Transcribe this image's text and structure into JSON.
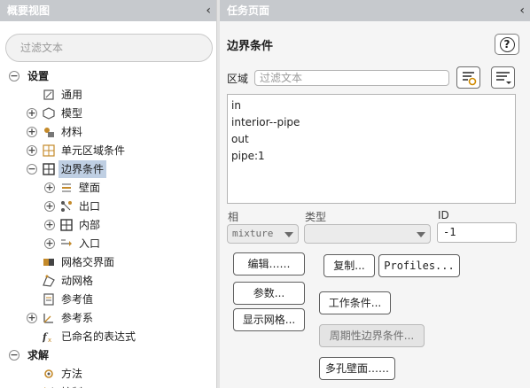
{
  "left_panel": {
    "title": "概要视图",
    "collapse_glyph": "‹",
    "filter_placeholder": "过滤文本",
    "tree": [
      {
        "label": "设置",
        "level": 0,
        "toggle": "−",
        "bold": true,
        "icon": ""
      },
      {
        "label": "通用",
        "level": 1,
        "toggle": "",
        "icon": "general-icon"
      },
      {
        "label": "模型",
        "level": 1,
        "toggle": "+",
        "icon": "models-icon"
      },
      {
        "label": "材料",
        "level": 1,
        "toggle": "+",
        "icon": "materials-icon"
      },
      {
        "label": "单元区域条件",
        "level": 1,
        "toggle": "+",
        "icon": "cell-zone-icon"
      },
      {
        "label": "边界条件",
        "level": 1,
        "toggle": "−",
        "icon": "boundary-conditions-icon",
        "selected": true
      },
      {
        "label": "壁面",
        "level": 2,
        "toggle": "+",
        "icon": "wall-icon"
      },
      {
        "label": "出口",
        "level": 2,
        "toggle": "+",
        "icon": "outlet-icon"
      },
      {
        "label": "内部",
        "level": 2,
        "toggle": "+",
        "icon": "interior-icon"
      },
      {
        "label": "入口",
        "level": 2,
        "toggle": "+",
        "icon": "inlet-icon"
      },
      {
        "label": "网格交界面",
        "level": 1,
        "toggle": "",
        "icon": "mesh-interface-icon"
      },
      {
        "label": "动网格",
        "level": 1,
        "toggle": "",
        "icon": "dynamic-mesh-icon"
      },
      {
        "label": "参考值",
        "level": 1,
        "toggle": "",
        "icon": "reference-values-icon"
      },
      {
        "label": "参考系",
        "level": 1,
        "toggle": "+",
        "icon": "reference-frame-icon"
      },
      {
        "label": "已命名的表达式",
        "level": 1,
        "toggle": "",
        "icon": "named-expressions-icon"
      },
      {
        "label": "求解",
        "level": 0,
        "toggle": "−",
        "bold": true,
        "icon": ""
      },
      {
        "label": "方法",
        "level": 1,
        "toggle": "",
        "icon": "methods-icon"
      },
      {
        "label": "控制",
        "level": 1,
        "toggle": "",
        "icon": "controls-icon"
      }
    ]
  },
  "task_panel": {
    "title": "任务页面",
    "collapse_glyph": "‹",
    "heading": "边界条件",
    "help_label": "?",
    "zone_label": "区域",
    "zone_filter_placeholder": "过滤文本",
    "zones": [
      "in",
      "interior--pipe",
      "out",
      "pipe:1"
    ],
    "phase_label": "相",
    "phase_value": "mixture",
    "type_label": "类型",
    "type_value": "",
    "id_label": "ID",
    "id_value": "-1",
    "buttons": {
      "edit": "编辑……",
      "copy": "复制...",
      "profiles": "Profiles...",
      "parameters": "参数...",
      "operating_conditions": "工作条件...",
      "display_mesh": "显示网格...",
      "periodic_conditions": "周期性边界条件...",
      "perforated_walls": "多孔壁面……"
    }
  },
  "colors": {
    "header_bg": "#c6c9cd",
    "selection": "#bfcfe3",
    "panel_bg": "#f5f5f5"
  }
}
